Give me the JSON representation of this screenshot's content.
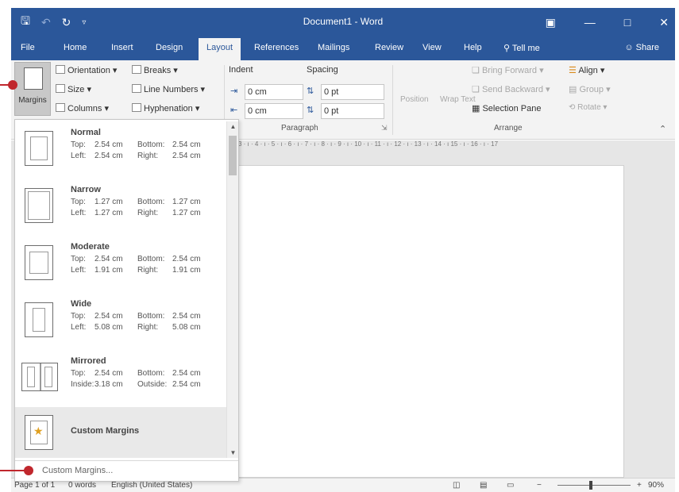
{
  "titlebar": {
    "title": "Document1 - Word",
    "save_icon": "save-icon",
    "undo_icon": "undo-icon",
    "redo_icon": "redo-icon",
    "customize_icon": "customize-qat-icon",
    "ribbon_display_icon": "ribbon-display-options-icon",
    "minimize_icon": "minimize-icon",
    "restore_icon": "restore-icon",
    "close_icon": "close-icon",
    "color": "#2b579a"
  },
  "tabs": [
    "File",
    "Home",
    "Insert",
    "Design",
    "Layout",
    "References",
    "Mailings",
    "Review",
    "View",
    "Help"
  ],
  "active_tab": "Layout",
  "tell_me": "Tell me",
  "share": "Share",
  "ribbon": {
    "margins": "Margins",
    "orientation": "Orientation",
    "size": "Size",
    "columns": "Columns",
    "breaks": "Breaks",
    "line_numbers": "Line Numbers",
    "hyphenation": "Hyphenation",
    "indent_label": "Indent",
    "spacing_label": "Spacing",
    "indent_left": "0 cm",
    "indent_right": "0 cm",
    "spacing_before": "0 pt",
    "spacing_after": "0 pt",
    "paragraph_group": "Paragraph",
    "position": "Position",
    "wrap_text": "Wrap Text",
    "bring_forward": "Bring Forward",
    "send_backward": "Send Backward",
    "selection_pane": "Selection Pane",
    "align": "Align",
    "group": "Group",
    "rotate": "Rotate",
    "arrange_group": "Arrange"
  },
  "ruler": "3 · ı · 4 · ı · 5 · ı · 6 · ı · 7 · ı · 8 · ı · 9 · ı · 10 · ı · 11 · ı · 12 · ı · 13 · ı · 14 · ı 15 · ı · 16 · ı · 17",
  "margins_menu": {
    "options": [
      {
        "name": "Normal",
        "k1": "Top:",
        "v1": "2.54 cm",
        "k2": "Bottom:",
        "v2": "2.54 cm",
        "k3": "Left:",
        "v3": "2.54 cm",
        "k4": "Right:",
        "v4": "2.54 cm"
      },
      {
        "name": "Narrow",
        "k1": "Top:",
        "v1": "1.27 cm",
        "k2": "Bottom:",
        "v2": "1.27 cm",
        "k3": "Left:",
        "v3": "1.27 cm",
        "k4": "Right:",
        "v4": "1.27 cm"
      },
      {
        "name": "Moderate",
        "k1": "Top:",
        "v1": "2.54 cm",
        "k2": "Bottom:",
        "v2": "2.54 cm",
        "k3": "Left:",
        "v3": "1.91 cm",
        "k4": "Right:",
        "v4": "1.91 cm"
      },
      {
        "name": "Wide",
        "k1": "Top:",
        "v1": "2.54 cm",
        "k2": "Bottom:",
        "v2": "2.54 cm",
        "k3": "Left:",
        "v3": "5.08 cm",
        "k4": "Right:",
        "v4": "5.08 cm"
      },
      {
        "name": "Mirrored",
        "k1": "Top:",
        "v1": "2.54 cm",
        "k2": "Bottom:",
        "v2": "2.54 cm",
        "k3": "Inside:",
        "v3": "3.18 cm",
        "k4": "Outside:",
        "v4": "2.54 cm"
      }
    ],
    "last_custom": "Custom Margins",
    "footer": "Custom Margins..."
  },
  "status": {
    "page": "Page 1 of 1",
    "words": "0 words",
    "language": "English (United States)",
    "zoom": "90%"
  },
  "callout_color": "#c0272d"
}
